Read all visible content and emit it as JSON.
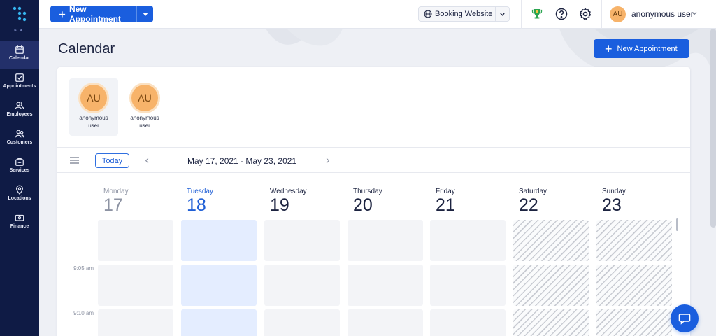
{
  "sidebar": {
    "collapse_glyph": "▸◂",
    "items": [
      {
        "label": "Calendar",
        "icon": "calendar-icon",
        "active": true
      },
      {
        "label": "Appointments",
        "icon": "checkbox-icon"
      },
      {
        "label": "Employees",
        "icon": "employees-icon"
      },
      {
        "label": "Customers",
        "icon": "customers-icon"
      },
      {
        "label": "Services",
        "icon": "briefcase-icon"
      },
      {
        "label": "Locations",
        "icon": "map-pin-icon"
      },
      {
        "label": "Finance",
        "icon": "money-icon"
      }
    ]
  },
  "topbar": {
    "new_appointment_label": "New Appointment",
    "booking_website_label": "Booking Website",
    "user_initials": "AU",
    "user_name": "anonymous user",
    "icons": [
      "trophy-icon",
      "help-icon",
      "settings-icon"
    ]
  },
  "page": {
    "title": "Calendar",
    "new_appointment_label": "New Appointment"
  },
  "employees": [
    {
      "initials": "AU",
      "name": "anonymous user",
      "selected": true
    },
    {
      "initials": "AU",
      "name": "anonymous user",
      "selected": false
    }
  ],
  "calendar": {
    "today_label": "Today",
    "range": "May 17, 2021 - May 23, 2021",
    "days": [
      {
        "name": "Monday",
        "num": "17",
        "state": "past"
      },
      {
        "name": "Tuesday",
        "num": "18",
        "state": "today"
      },
      {
        "name": "Wednesday",
        "num": "19",
        "state": "normal"
      },
      {
        "name": "Thursday",
        "num": "20",
        "state": "normal"
      },
      {
        "name": "Friday",
        "num": "21",
        "state": "normal"
      },
      {
        "name": "Saturday",
        "num": "22",
        "state": "off"
      },
      {
        "name": "Sunday",
        "num": "23",
        "state": "off"
      }
    ],
    "time_labels": [
      "9:05 am",
      "9:10 am"
    ]
  },
  "colors": {
    "primary": "#1a5ede",
    "sidebar": "#0f1b45",
    "avatar": "#f7b36a",
    "today": "#1f5fd6"
  }
}
